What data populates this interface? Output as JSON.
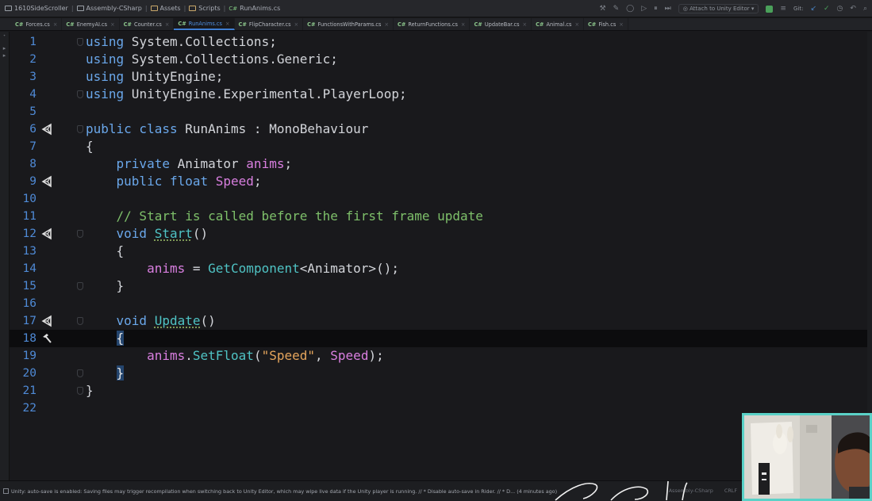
{
  "navbar": {
    "breadcrumbs": [
      "1610SideScroller",
      "Assembly-CSharp",
      "Assets",
      "Scripts",
      "RunAnims.cs"
    ],
    "attach_label": "Attach to Unity Editor",
    "git_label": "Git:"
  },
  "tabs": [
    {
      "label": "Forces.cs",
      "active": false
    },
    {
      "label": "EnemyAI.cs",
      "active": false
    },
    {
      "label": "Counter.cs",
      "active": false
    },
    {
      "label": "RunAnims.cs",
      "active": true
    },
    {
      "label": "FlipCharacter.cs",
      "active": false
    },
    {
      "label": "FunctionsWithParams.cs",
      "active": false
    },
    {
      "label": "ReturnFunctions.cs",
      "active": false
    },
    {
      "label": "UpdateBar.cs",
      "active": false
    },
    {
      "label": "Animal.cs",
      "active": false
    },
    {
      "label": "Fish.cs",
      "active": false
    }
  ],
  "tab_lang_prefix": "C#",
  "editor": {
    "current_line": 18,
    "lines": [
      {
        "n": "1",
        "code": "using System.Collections;"
      },
      {
        "n": "2",
        "code": "using System.Collections.Generic;"
      },
      {
        "n": "3",
        "code": "using UnityEngine;"
      },
      {
        "n": "4",
        "code": "using UnityEngine.Experimental.PlayerLoop;"
      },
      {
        "n": "5",
        "code": ""
      },
      {
        "n": "6",
        "code": "public class RunAnims : MonoBehaviour"
      },
      {
        "n": "7",
        "code": "{"
      },
      {
        "n": "8",
        "code": "    private Animator anims;"
      },
      {
        "n": "9",
        "code": "    public float Speed;"
      },
      {
        "n": "10",
        "code": ""
      },
      {
        "n": "11",
        "code": "    // Start is called before the first frame update"
      },
      {
        "n": "12",
        "code": "    void Start()"
      },
      {
        "n": "13",
        "code": "    {"
      },
      {
        "n": "14",
        "code": "        anims = GetComponent<Animator>();"
      },
      {
        "n": "15",
        "code": "    }"
      },
      {
        "n": "16",
        "code": ""
      },
      {
        "n": "17",
        "code": "    void Update()"
      },
      {
        "n": "18",
        "code": "    {"
      },
      {
        "n": "19",
        "code": "        anims.SetFloat(\"Speed\", Speed);"
      },
      {
        "n": "20",
        "code": "    }"
      },
      {
        "n": "21",
        "code": "}"
      },
      {
        "n": "22",
        "code": ""
      }
    ],
    "markers": {
      "6": "unity-icon",
      "9": "unity-icon",
      "12": "unity-icon",
      "17": "unity-icon",
      "18": "hammer-icon"
    }
  },
  "statusbar": {
    "message": "Unity: auto-save is enabled: Saving files may trigger recompilation when switching back to Unity Editor, which may wipe live data if the Unity player is running. // * Disable auto-save in Rider. // * D... (4 minutes ago)",
    "project": "Assembly-CSharp",
    "line_ending": "CRLF"
  },
  "colors": {
    "keyword": "#6aa7ea",
    "field": "#d97fe0",
    "method": "#4fc3c4",
    "string": "#e5a55c",
    "comment": "#7ec06a",
    "line_number": "#4f8ad6",
    "webcam_border": "#5ad1c7"
  }
}
